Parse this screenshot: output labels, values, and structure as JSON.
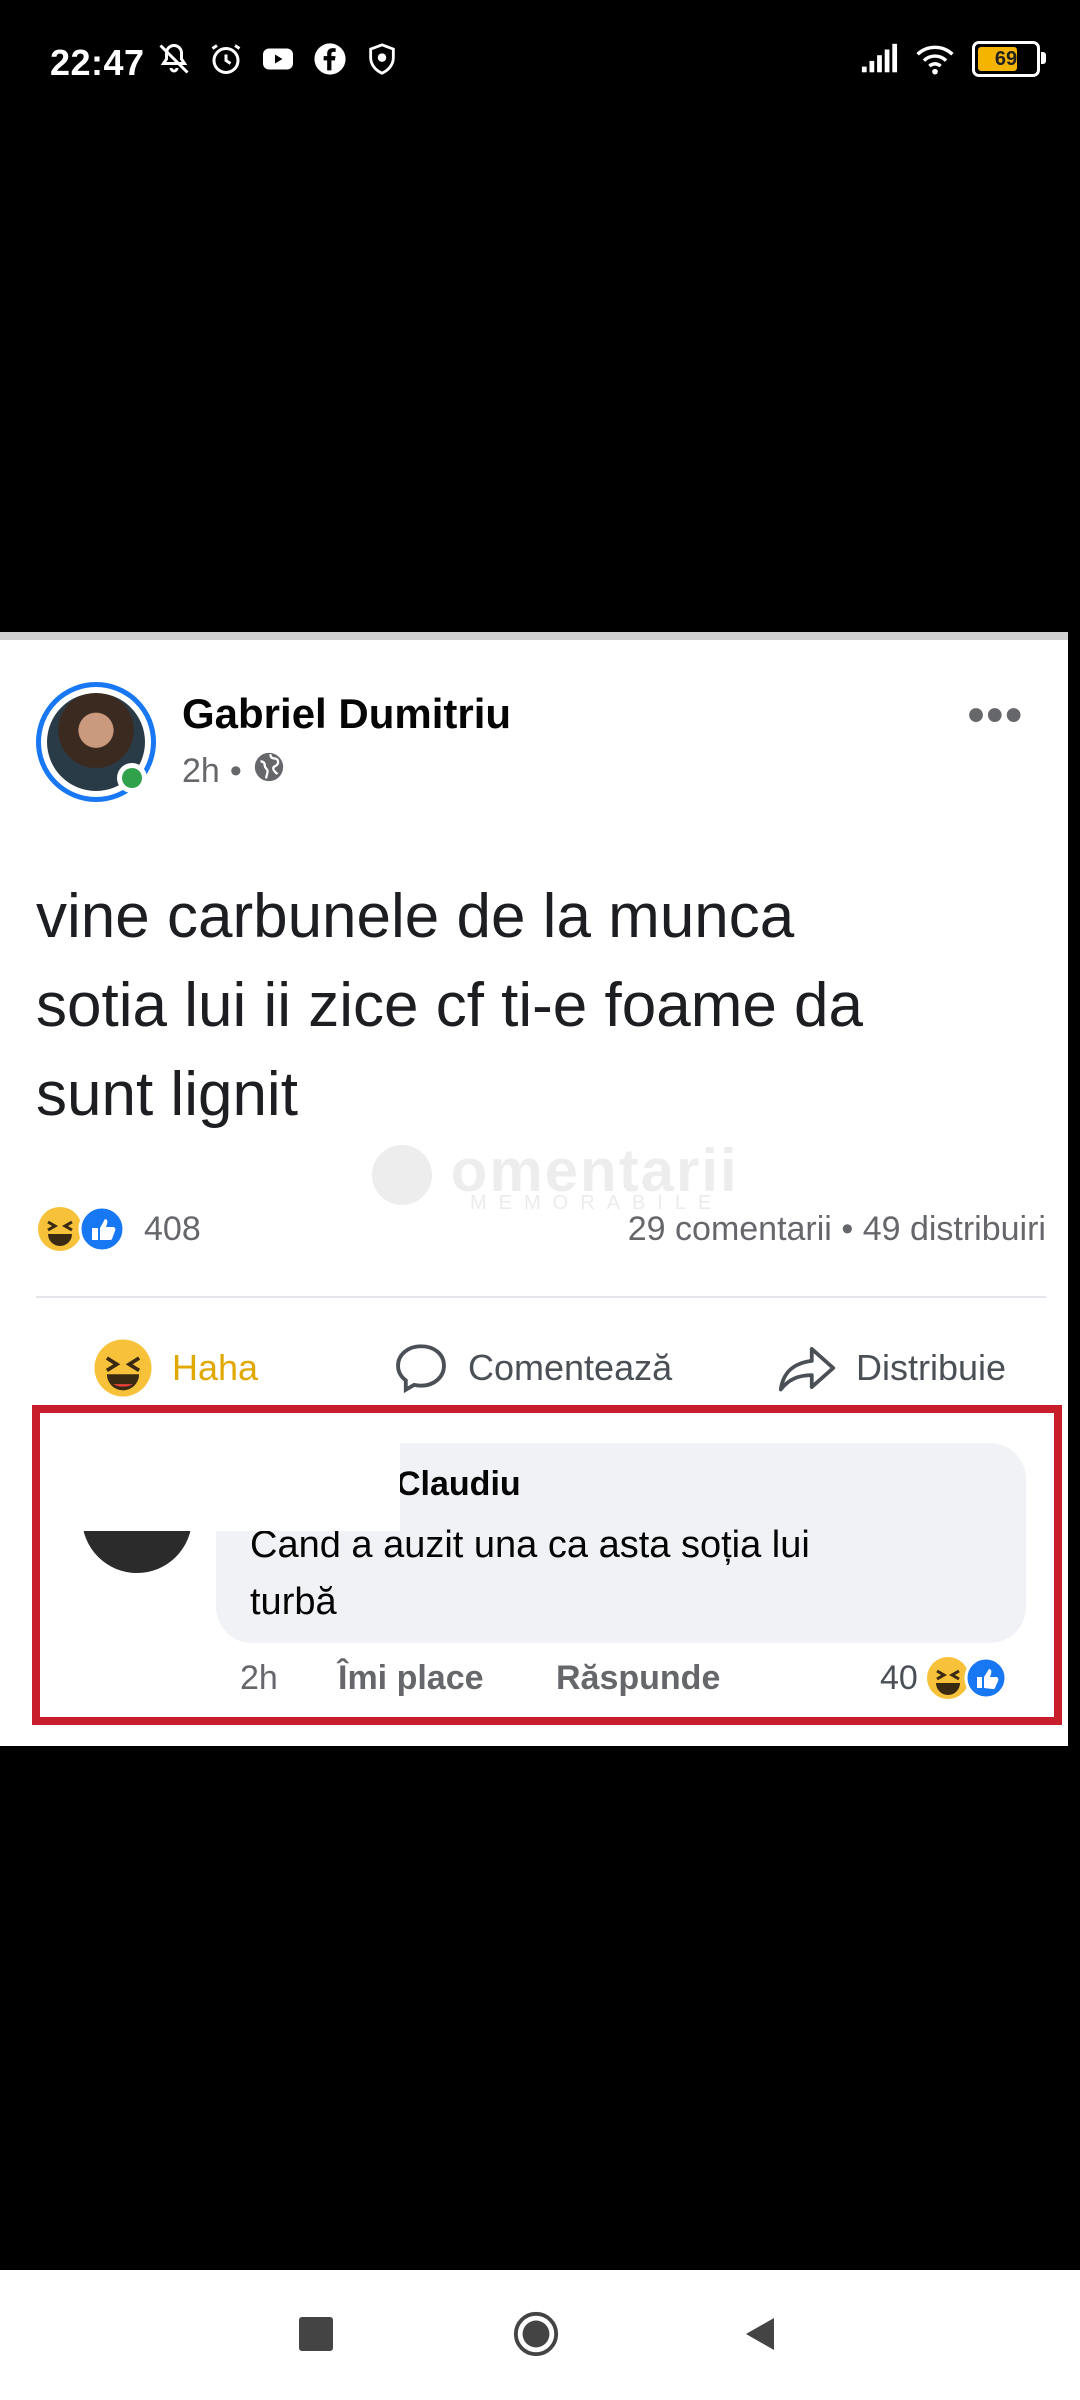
{
  "status_bar": {
    "time": "22:47",
    "left_icons": [
      "mute-icon",
      "alarm-icon",
      "youtube-icon",
      "facebook-icon",
      "vpn-icon"
    ],
    "right_icons": [
      "signal-icon",
      "wifi-icon"
    ],
    "battery": "69",
    "battery_level": 0.69
  },
  "post": {
    "author": "Gabriel Dumitriu",
    "time": "2h",
    "separator": "•",
    "privacy_icon": "globe-icon",
    "text_lines": [
      "vine carbunele de la munca",
      "sotia lui ii zice cf ti-e foame da",
      "sunt lignit"
    ],
    "reaction_count": "408",
    "comments": "29 comentarii",
    "stats_separator": "•",
    "shares": "49 distribuiri",
    "watermark": "omentarii",
    "watermark_sub": "MEMORABILE",
    "actions": {
      "haha": "Haha",
      "comment": "Comentează",
      "share": "Distribuie"
    },
    "colors": {
      "accent": "#1877f2",
      "haha": "#e0a800",
      "highlight": "#c81e2b"
    }
  },
  "comment": {
    "author": "Claudiu",
    "text_lines": [
      "Cand a auzit una ca asta soția lui",
      "turbă"
    ],
    "time": "2h",
    "like": "Îmi place",
    "reply": "Răspunde",
    "reaction_count": "40"
  }
}
